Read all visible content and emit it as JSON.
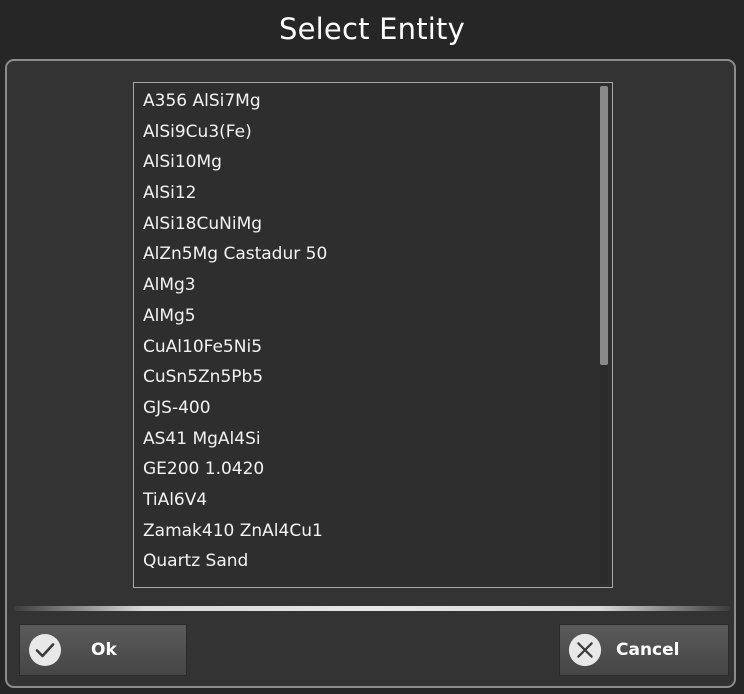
{
  "dialog": {
    "title": "Select Entity"
  },
  "list": {
    "items": [
      "A356 AlSi7Mg",
      "AlSi9Cu3(Fe)",
      "AlSi10Mg",
      "AlSi12",
      "AlSi18CuNiMg",
      "AlZn5Mg Castadur 50",
      "AlMg3",
      "AlMg5",
      "CuAl10Fe5Ni5",
      "CuSn5Zn5Pb5",
      "GJS-400",
      "AS41 MgAl4Si",
      "GE200 1.0420",
      "TiAl6V4",
      "Zamak410 ZnAl4Cu1",
      "Quartz Sand"
    ],
    "scroll_thumb_fraction": 0.56
  },
  "buttons": {
    "ok": {
      "label": "Ok",
      "icon": "check-circle-icon"
    },
    "cancel": {
      "label": "Cancel",
      "icon": "x-circle-icon"
    }
  },
  "colors": {
    "background": "#262626",
    "panel": "#333333",
    "panel_border": "#8c8c8c",
    "button": "#505050",
    "text": "#ffffff"
  }
}
